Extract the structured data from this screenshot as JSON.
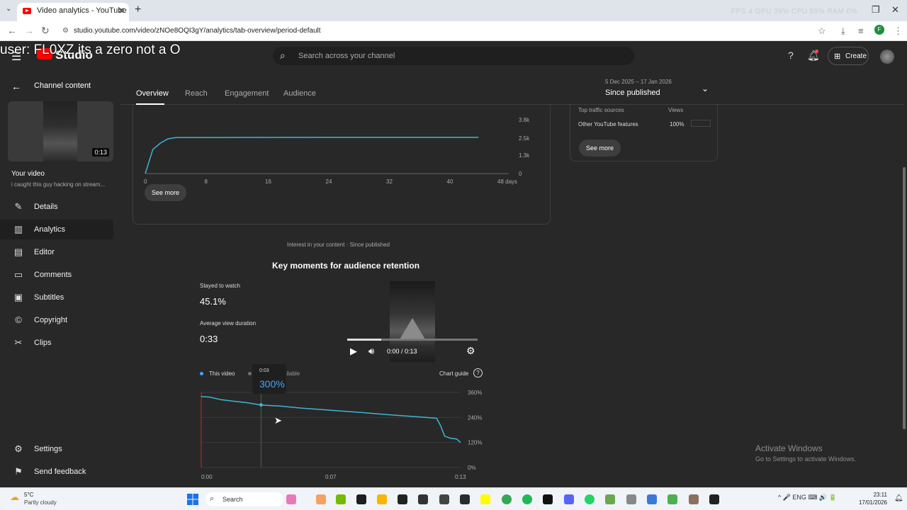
{
  "browser": {
    "tab_title": "Video analytics - YouTube Stud",
    "new_tab": "+",
    "tab_close": "✕",
    "overlay_stats": "FPS 4   GPU 39%   CPU 55%   RAM 0%",
    "url": "studio.youtube.com/video/zNOe8OQI3gY/analytics/tab-overview/period-default",
    "profile_initial": "F"
  },
  "overlay_caption": "user: FL0XZ its a zero not a O",
  "header": {
    "logo": "Studio",
    "search_placeholder": "Search across your channel",
    "create_label": "Create"
  },
  "sidebar": {
    "back_label": "Channel content",
    "thumb_duration": "0:13",
    "your_video": "Your video",
    "video_title": "i caught this guy hacking on stream...",
    "items": [
      {
        "label": "Details",
        "icon": "pencil-icon"
      },
      {
        "label": "Analytics",
        "icon": "analytics-icon"
      },
      {
        "label": "Editor",
        "icon": "editor-icon"
      },
      {
        "label": "Comments",
        "icon": "comments-icon"
      },
      {
        "label": "Subtitles",
        "icon": "subtitles-icon"
      },
      {
        "label": "Copyright",
        "icon": "copyright-icon"
      },
      {
        "label": "Clips",
        "icon": "scissors-icon"
      }
    ],
    "settings": "Settings",
    "feedback": "Send feedback"
  },
  "tabs": [
    "Overview",
    "Reach",
    "Engagement",
    "Audience"
  ],
  "period": {
    "range": "5 Dec 2025 – 17 Jan 2026",
    "label": "Since published"
  },
  "views_card": {
    "see_more": "See more",
    "chart_data": {
      "type": "line",
      "x_ticks": [
        "0",
        "8",
        "16",
        "24",
        "32",
        "40",
        "48 days"
      ],
      "y_ticks": [
        "3.8k",
        "2.5k",
        "1.3k",
        "0"
      ],
      "ylim": [
        0,
        3800
      ],
      "xlim": [
        0,
        48
      ],
      "x": [
        0,
        1,
        2,
        3,
        4,
        8,
        16,
        24,
        32,
        40,
        44
      ],
      "y": [
        0,
        1700,
        2150,
        2450,
        2540,
        2545,
        2550,
        2555,
        2555,
        2555,
        2555
      ]
    }
  },
  "traffic_card": {
    "header_sources": "Top traffic sources",
    "header_views": "Views",
    "row_source": "Other YouTube features",
    "row_value": "100%",
    "see_more": "See more"
  },
  "retention": {
    "interest_caption": "Interest in your content · Since published",
    "title": "Key moments for audience retention",
    "stayed_label": "Stayed to watch",
    "stayed_value": "45.1%",
    "avd_label": "Average view duration",
    "avd_value": "0:33",
    "player_time": "0:00 / 0:13",
    "legend_this": "This video",
    "legend_na": "tion not available",
    "chart_guide": "Chart guide",
    "tooltip_time": "0:03",
    "tooltip_value": "300%",
    "chart_data": {
      "type": "line",
      "x_ticks": [
        "0:00",
        "0:07",
        "0:13"
      ],
      "y_ticks": [
        "360%",
        "240%",
        "120%",
        "0%"
      ],
      "ylim": [
        0,
        360
      ],
      "xlim": [
        0,
        13
      ],
      "x": [
        0,
        0.4,
        1.0,
        1.6,
        2.2,
        3.0,
        4.0,
        5.0,
        6.0,
        7.0,
        8.0,
        9.0,
        10.0,
        11.0,
        11.8,
        12.0,
        12.2,
        12.5,
        12.8,
        13.0
      ],
      "y": [
        340,
        338,
        325,
        318,
        312,
        300,
        294,
        285,
        278,
        271,
        264,
        256,
        249,
        242,
        236,
        200,
        150,
        140,
        137,
        120
      ]
    }
  },
  "watermark": {
    "line1": "Activate Windows",
    "line2": "Go to Settings to activate Windows."
  },
  "taskbar": {
    "temp": "5°C",
    "weather": "Partly cloudy",
    "search": "Search",
    "tray": "^   🎤   ENG   ⌨  🔊  🔋",
    "time": "23:11",
    "date": "17/01/2026"
  }
}
